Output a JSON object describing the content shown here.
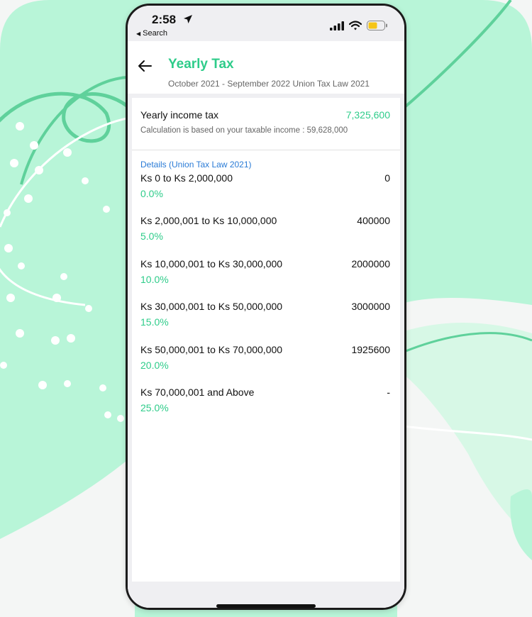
{
  "status_bar": {
    "time": "2:58",
    "back_app": "Search"
  },
  "header": {
    "title": "Yearly Tax",
    "subtitle": "October 2021 - September 2022 Union Tax Law 2021"
  },
  "summary": {
    "label": "Yearly income tax",
    "value": "7,325,600",
    "note": "Calculation is based on your taxable income : 59,628,000"
  },
  "details": {
    "heading": "Details (Union Tax Law 2021)",
    "brackets": [
      {
        "range": "Ks 0 to Ks 2,000,000",
        "rate": "0.0%",
        "amount": "0"
      },
      {
        "range": "Ks 2,000,001 to Ks 10,000,000",
        "rate": "5.0%",
        "amount": "400000"
      },
      {
        "range": "Ks 10,000,001 to Ks 30,000,000",
        "rate": "10.0%",
        "amount": "2000000"
      },
      {
        "range": "Ks 30,000,001 to Ks 50,000,000",
        "rate": "15.0%",
        "amount": "3000000"
      },
      {
        "range": "Ks 50,000,001 to Ks 70,000,000",
        "rate": "20.0%",
        "amount": "1925600"
      },
      {
        "range": "Ks 70,000,001 and Above",
        "rate": "25.0%",
        "amount": "-"
      }
    ]
  },
  "colors": {
    "accent": "#2ecc8a",
    "link": "#2a7bd6",
    "background_mint": "#b8f5d8"
  },
  "icons": {
    "back": "back-arrow-icon",
    "location": "location-arrow-icon",
    "signal": "cellular-signal-icon",
    "wifi": "wifi-icon",
    "battery": "battery-icon"
  }
}
